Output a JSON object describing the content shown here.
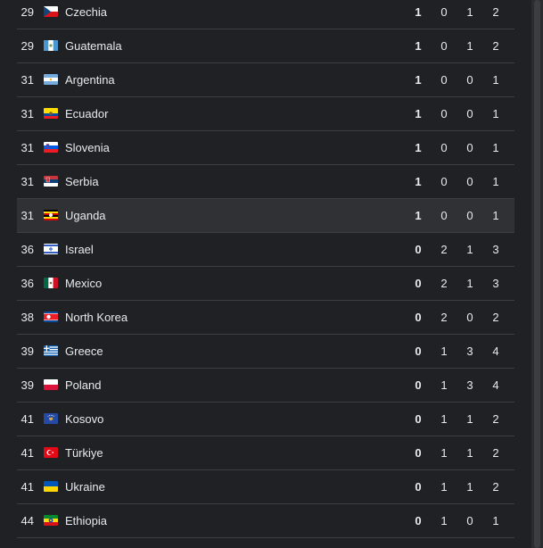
{
  "rows": [
    {
      "rank": "29",
      "country": "Czechia",
      "gold": "1",
      "silver": "0",
      "bronze": "1",
      "total": "2",
      "flag": "czechia-flag-icon"
    },
    {
      "rank": "29",
      "country": "Guatemala",
      "gold": "1",
      "silver": "0",
      "bronze": "1",
      "total": "2",
      "flag": "guatemala-flag-icon"
    },
    {
      "rank": "31",
      "country": "Argentina",
      "gold": "1",
      "silver": "0",
      "bronze": "0",
      "total": "1",
      "flag": "argentina-flag-icon"
    },
    {
      "rank": "31",
      "country": "Ecuador",
      "gold": "1",
      "silver": "0",
      "bronze": "0",
      "total": "1",
      "flag": "ecuador-flag-icon"
    },
    {
      "rank": "31",
      "country": "Slovenia",
      "gold": "1",
      "silver": "0",
      "bronze": "0",
      "total": "1",
      "flag": "slovenia-flag-icon"
    },
    {
      "rank": "31",
      "country": "Serbia",
      "gold": "1",
      "silver": "0",
      "bronze": "0",
      "total": "1",
      "flag": "serbia-flag-icon"
    },
    {
      "rank": "31",
      "country": "Uganda",
      "gold": "1",
      "silver": "0",
      "bronze": "0",
      "total": "1",
      "flag": "uganda-flag-icon"
    },
    {
      "rank": "36",
      "country": "Israel",
      "gold": "0",
      "silver": "2",
      "bronze": "1",
      "total": "3",
      "flag": "israel-flag-icon"
    },
    {
      "rank": "36",
      "country": "Mexico",
      "gold": "0",
      "silver": "2",
      "bronze": "1",
      "total": "3",
      "flag": "mexico-flag-icon"
    },
    {
      "rank": "38",
      "country": "North Korea",
      "gold": "0",
      "silver": "2",
      "bronze": "0",
      "total": "2",
      "flag": "north-korea-flag-icon"
    },
    {
      "rank": "39",
      "country": "Greece",
      "gold": "0",
      "silver": "1",
      "bronze": "3",
      "total": "4",
      "flag": "greece-flag-icon"
    },
    {
      "rank": "39",
      "country": "Poland",
      "gold": "0",
      "silver": "1",
      "bronze": "3",
      "total": "4",
      "flag": "poland-flag-icon"
    },
    {
      "rank": "41",
      "country": "Kosovo",
      "gold": "0",
      "silver": "1",
      "bronze": "1",
      "total": "2",
      "flag": "kosovo-flag-icon"
    },
    {
      "rank": "41",
      "country": "Türkiye",
      "gold": "0",
      "silver": "1",
      "bronze": "1",
      "total": "2",
      "flag": "turkiye-flag-icon"
    },
    {
      "rank": "41",
      "country": "Ukraine",
      "gold": "0",
      "silver": "1",
      "bronze": "1",
      "total": "2",
      "flag": "ukraine-flag-icon"
    },
    {
      "rank": "44",
      "country": "Ethiopia",
      "gold": "0",
      "silver": "1",
      "bronze": "0",
      "total": "1",
      "flag": "ethiopia-flag-icon"
    }
  ],
  "colors": {
    "background": "#202124",
    "row_highlight": "#303134",
    "divider": "#3c4043",
    "text": "#e8eaed"
  }
}
